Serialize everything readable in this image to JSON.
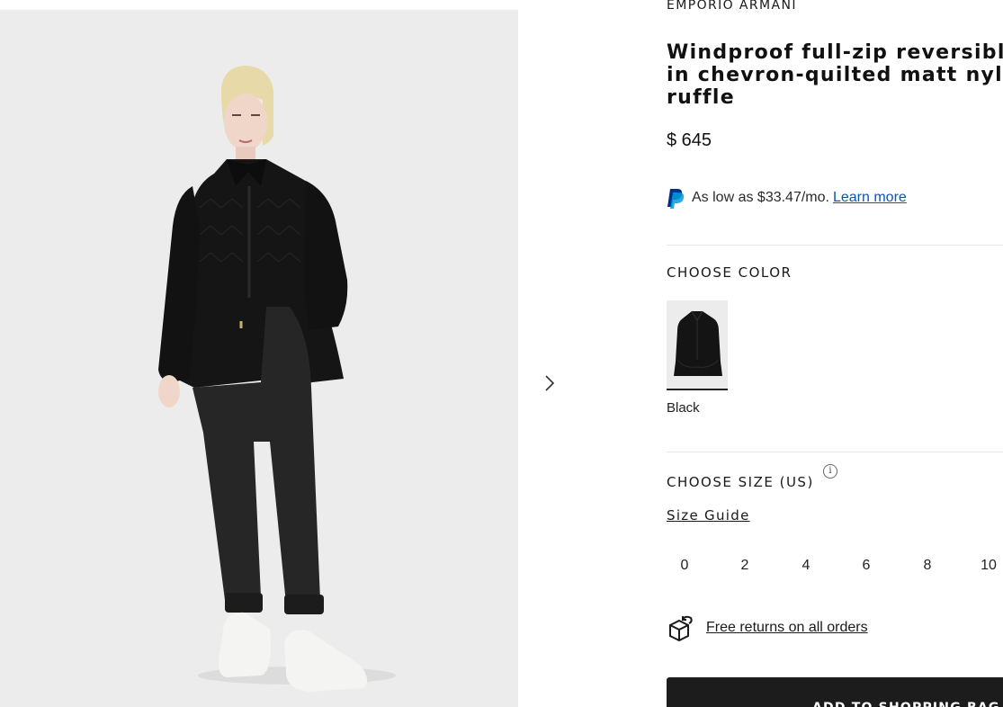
{
  "brand": "EMPORIO ARMANI",
  "product": {
    "title": "Windproof full-zip reversible in chevron-quilted matt nylon ruffle",
    "title_line1": "Windproof full-zip reversibl",
    "title_line2": "in chevron-quilted matt nyl",
    "title_line3": "ruffle",
    "price": "$ 645"
  },
  "financing": {
    "text": "As low as $33.47/mo.",
    "link": "Learn more",
    "icon": "paypal-icon",
    "brand_color": "#003087"
  },
  "color": {
    "label": "CHOOSE COLOR",
    "options": [
      {
        "name": "Black",
        "selected": true
      }
    ]
  },
  "size": {
    "label": "CHOOSE SIZE (US)",
    "info_glyph": "i",
    "guide": "Size Guide",
    "options": [
      "0",
      "2",
      "4",
      "6",
      "8",
      "10"
    ]
  },
  "returns": {
    "text": "Free returns on all orders",
    "icon": "return-box-icon"
  },
  "cta": {
    "label": "ADD TO SHOPPING BAG",
    "color": "#1c1c1c"
  },
  "gallery": {
    "next_icon": "chevron-right-icon",
    "background": "#ececec"
  }
}
